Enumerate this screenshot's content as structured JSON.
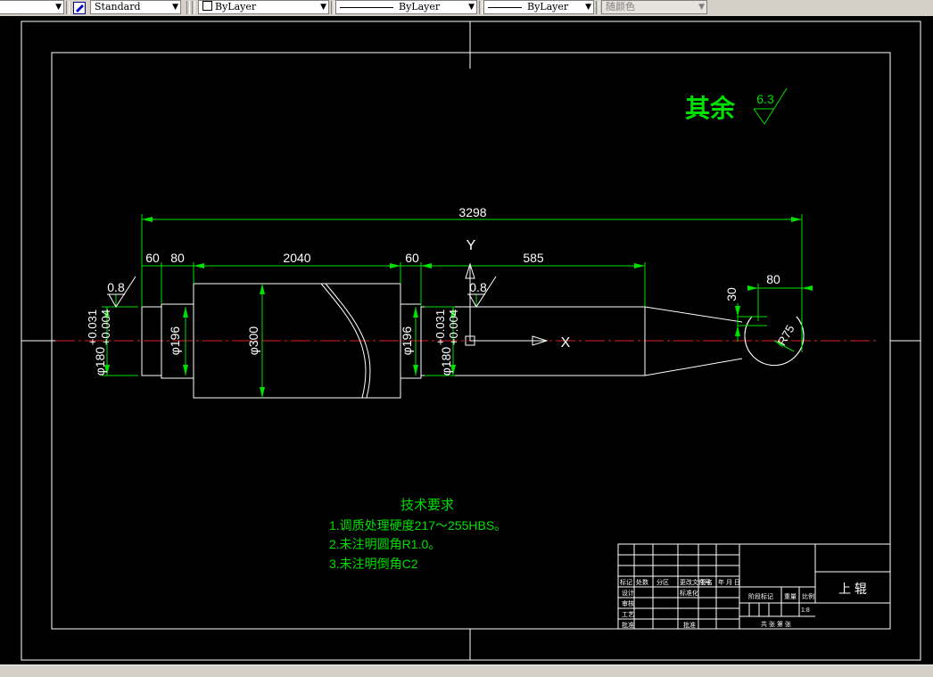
{
  "toolbar": {
    "text_style": "Standard",
    "layer_combo": "ByLayer",
    "linetype_combo": "ByLayer",
    "lineweight_combo": "ByLayer",
    "plotstyle_combo": "随颜色"
  },
  "drawing": {
    "surface_remaining_label": "其余",
    "surface_remaining_value": "6.3",
    "roughness_left": "0.8",
    "roughness_right": "0.8",
    "dims": {
      "overall": "3298",
      "d60_left": "60",
      "d80_left": "80",
      "body_length": "2040",
      "d60_right": "60",
      "d585": "585",
      "d80_right": "80",
      "d30": "30",
      "radius": "R75",
      "phi196_left": "φ196",
      "phi300": "φ300",
      "phi196_right": "φ196",
      "phi180_left": "φ180",
      "phi180_right": "φ180",
      "tol_left_upper": "+0.031",
      "tol_left_lower": "+0.004",
      "tol_right_upper": "+0.031",
      "tol_right_lower": "+0.004"
    },
    "ucs": {
      "x": "X",
      "y": "Y"
    },
    "tech_req": {
      "title": "技术要求",
      "items": [
        "1.调质处理硬度217～255HBS。",
        "2.未注明圆角R1.0。",
        "3.未注明倒角C2"
      ]
    },
    "title_block": {
      "part_name": "上 辊",
      "scale": "1:8",
      "h_mark": "标记",
      "h_qty": "处数",
      "h_zone": "分区",
      "h_docno": "更改文件号",
      "h_sign": "签名",
      "h_date": "年 月 日",
      "h_design": "设计",
      "h_std": "标准化",
      "h_check": "审核",
      "h_process": "工艺",
      "h_approve": "批准",
      "h_stage": "阶段标记",
      "h_weight": "重量",
      "h_ratio": "比例",
      "h_sheets": "共  张  第  张"
    }
  }
}
